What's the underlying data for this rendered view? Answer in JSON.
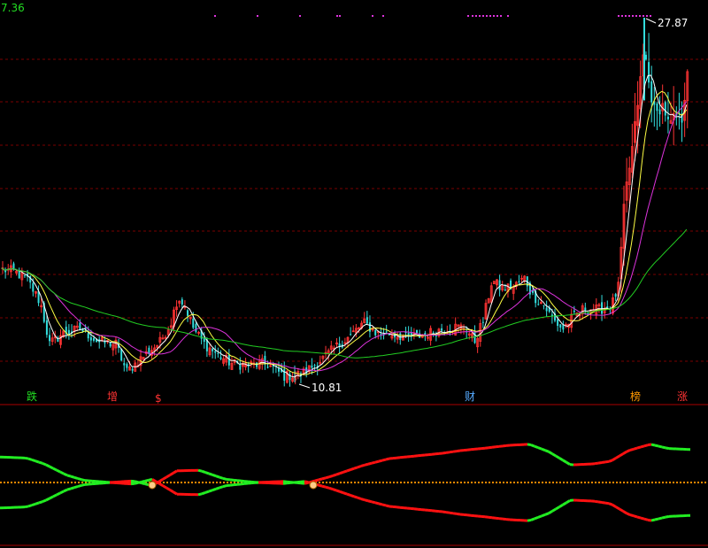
{
  "axis": {
    "corner_value": "7.36"
  },
  "annotations": {
    "high": "27.87",
    "low": "10.81"
  },
  "markers": [
    {
      "id": "die",
      "text": "跌",
      "color": "#22dd22"
    },
    {
      "id": "zeng",
      "text": "增",
      "color": "#ff3333"
    },
    {
      "id": "dollar",
      "text": "$",
      "color": "#ff3333"
    },
    {
      "id": "cai",
      "text": "财",
      "color": "#55aaff"
    },
    {
      "id": "bang",
      "text": "榜",
      "color": "#ff9900"
    },
    {
      "id": "zhang",
      "text": "涨",
      "color": "#ff3333"
    }
  ],
  "colors": {
    "background": "#000000",
    "up": "#ff3333",
    "down": "#33dddd",
    "ma_white": "#ffffff",
    "ma_yellow": "#ffff44",
    "ma_magenta": "#dd33dd",
    "ma_green": "#22cc22",
    "grid": "#7a0000",
    "osc_green": "#22ee22",
    "osc_red": "#ff1111",
    "center_dash": "#ff8800"
  },
  "chart_data": {
    "type": "candlestick",
    "price_range": [
      7.36,
      30.0
    ],
    "high": 27.87,
    "low": 10.81,
    "close_anchors": [
      [
        0,
        16.1
      ],
      [
        15,
        16.0
      ],
      [
        30,
        15.6
      ],
      [
        45,
        14.5
      ],
      [
        55,
        12.6
      ],
      [
        70,
        13.1
      ],
      [
        90,
        13.3
      ],
      [
        110,
        12.7
      ],
      [
        130,
        12.6
      ],
      [
        142,
        11.3
      ],
      [
        160,
        12.0
      ],
      [
        180,
        12.7
      ],
      [
        192,
        13.6
      ],
      [
        200,
        14.8
      ],
      [
        208,
        14.4
      ],
      [
        218,
        13.3
      ],
      [
        230,
        12.6
      ],
      [
        245,
        12.1
      ],
      [
        260,
        11.7
      ],
      [
        280,
        11.6
      ],
      [
        300,
        11.7
      ],
      [
        320,
        11.1
      ],
      [
        340,
        11.2
      ],
      [
        360,
        11.8
      ],
      [
        380,
        12.5
      ],
      [
        395,
        13.0
      ],
      [
        410,
        13.6
      ],
      [
        425,
        13.1
      ],
      [
        440,
        13.1
      ],
      [
        460,
        12.9
      ],
      [
        475,
        13.0
      ],
      [
        490,
        13.2
      ],
      [
        510,
        13.4
      ],
      [
        525,
        13.4
      ],
      [
        535,
        12.7
      ],
      [
        545,
        13.7
      ],
      [
        555,
        15.6
      ],
      [
        565,
        15.2
      ],
      [
        580,
        15.3
      ],
      [
        592,
        15.7
      ],
      [
        600,
        14.9
      ],
      [
        612,
        14.5
      ],
      [
        625,
        13.7
      ],
      [
        635,
        13.3
      ],
      [
        645,
        13.8
      ],
      [
        660,
        14.3
      ],
      [
        675,
        14.2
      ],
      [
        690,
        14.4
      ],
      [
        698,
        15.3
      ],
      [
        705,
        19.5
      ],
      [
        712,
        21.3
      ],
      [
        720,
        24.0
      ],
      [
        727,
        26.5
      ],
      [
        733,
        24.5
      ],
      [
        740,
        23.3
      ],
      [
        748,
        23.8
      ],
      [
        755,
        22.8
      ],
      [
        762,
        23.3
      ],
      [
        770,
        23.1
      ],
      [
        777,
        26.0
      ]
    ],
    "mode_markers": {
      "top_dots_color": "#dd33dd"
    },
    "oscillator": {
      "type": "line",
      "range": [
        -1,
        1
      ],
      "anchors": [
        [
          0,
          0.48
        ],
        [
          30,
          0.46
        ],
        [
          50,
          0.35
        ],
        [
          75,
          0.14
        ],
        [
          95,
          0.04
        ],
        [
          125,
          0.0
        ],
        [
          150,
          0.03
        ],
        [
          172,
          -0.06
        ],
        [
          200,
          0.22
        ],
        [
          225,
          0.23
        ],
        [
          255,
          0.06
        ],
        [
          290,
          0.0
        ],
        [
          320,
          0.02
        ],
        [
          345,
          -0.02
        ],
        [
          375,
          0.12
        ],
        [
          410,
          0.32
        ],
        [
          440,
          0.45
        ],
        [
          470,
          0.5
        ],
        [
          500,
          0.55
        ],
        [
          520,
          0.6
        ],
        [
          550,
          0.65
        ],
        [
          575,
          0.7
        ],
        [
          598,
          0.72
        ],
        [
          620,
          0.58
        ],
        [
          645,
          0.33
        ],
        [
          670,
          0.35
        ],
        [
          690,
          0.4
        ],
        [
          710,
          0.6
        ],
        [
          735,
          0.72
        ],
        [
          755,
          0.64
        ],
        [
          780,
          0.62
        ]
      ],
      "mirrored": true
    }
  }
}
